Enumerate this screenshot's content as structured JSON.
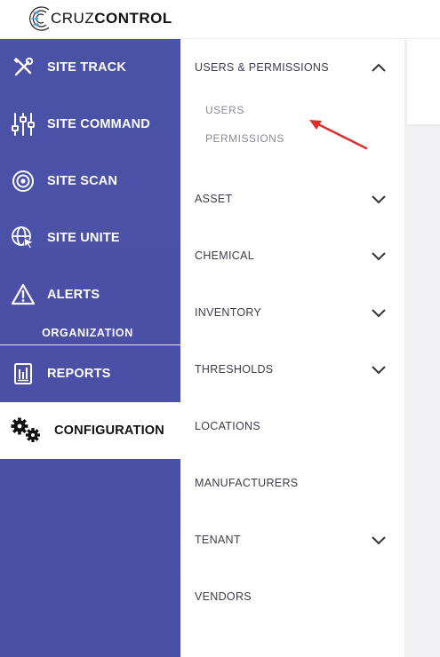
{
  "app": {
    "logo_text_light": "CRUZ",
    "logo_text_bold": "CONTROL"
  },
  "sidebar": {
    "items": [
      {
        "label": "SITE TRACK",
        "icon": "tools-icon"
      },
      {
        "label": "SITE COMMAND",
        "icon": "sliders-icon"
      },
      {
        "label": "SITE SCAN",
        "icon": "scan-target-icon"
      },
      {
        "label": "SITE UNITE",
        "icon": "globe-cursor-icon"
      },
      {
        "label": "ALERTS",
        "icon": "warning-triangle-icon"
      }
    ],
    "section_label": "ORGANIZATION",
    "org_items": [
      {
        "label": "REPORTS",
        "icon": "report-chart-icon"
      },
      {
        "label": "CONFIGURATION",
        "icon": "gears-icon",
        "active": true
      }
    ]
  },
  "submenu": {
    "items": [
      {
        "label": "USERS & PERMISSIONS",
        "expandable": true,
        "expanded": true,
        "children": [
          "USERS",
          "PERMISSIONS"
        ]
      },
      {
        "label": "ASSET",
        "expandable": true
      },
      {
        "label": "CHEMICAL",
        "expandable": true
      },
      {
        "label": "INVENTORY",
        "expandable": true
      },
      {
        "label": "THRESHOLDS",
        "expandable": true
      },
      {
        "label": "LOCATIONS",
        "expandable": false
      },
      {
        "label": "MANUFACTURERS",
        "expandable": false
      },
      {
        "label": "TENANT",
        "expandable": true
      },
      {
        "label": "VENDORS",
        "expandable": false
      }
    ]
  },
  "colors": {
    "sidebar_bg": "#4a50a6",
    "annotation_arrow": "#e32b2b",
    "text_dark": "#3c3c4c",
    "text_muted": "#8a8a96"
  }
}
